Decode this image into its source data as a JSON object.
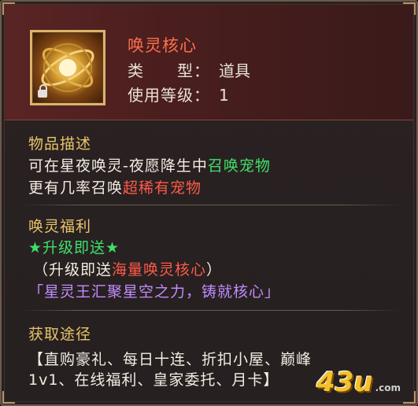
{
  "item": {
    "name": "唤灵核心",
    "type_label": "类　　型：",
    "type_value": "道具",
    "level_label": "使用等级：",
    "level_value": "1",
    "icon": "golden-orb-icon",
    "lock_icon": "lock-icon"
  },
  "description": {
    "title": "物品描述",
    "line1_prefix": "可在星夜唤灵-夜愿降生中",
    "line1_highlight": "召唤宠物",
    "line2_prefix": "更有几率召唤",
    "line2_highlight": "超稀有宠物"
  },
  "benefits": {
    "title": "唤灵福利",
    "headline": "★升级即送★",
    "detail_prefix": "（升级即送",
    "detail_highlight": "海量唤灵核心",
    "detail_suffix": "）",
    "quote": "「星灵王汇聚星空之力，铸就核心」"
  },
  "obtain": {
    "title": "获取途径",
    "line1": "【直购豪礼、每日十连、折扣小屋、巅峰",
    "line2": "1v1、在线福利、皇家委托、月卡】"
  },
  "watermark": {
    "text": "43u",
    "sub": ".com"
  },
  "colors": {
    "name": "#ff6e4a",
    "section_title": "#e8c46a",
    "green": "#3fe06a",
    "red": "#ff5a4a",
    "purple": "#c08cff"
  }
}
